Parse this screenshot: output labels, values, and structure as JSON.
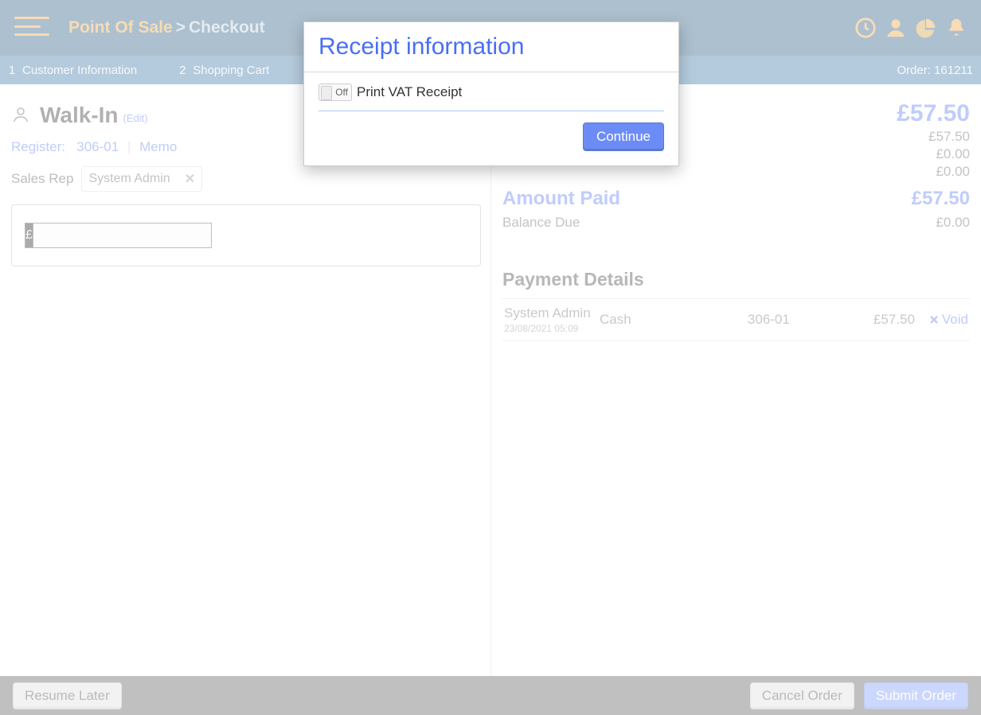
{
  "header": {
    "app_name": "Point Of Sale",
    "separator": ">",
    "location": "Checkout"
  },
  "progress": {
    "steps": [
      {
        "n": "1",
        "label": "Customer Information"
      },
      {
        "n": "2",
        "label": "Shopping Cart"
      },
      {
        "n": "3",
        "label": ""
      }
    ],
    "order_prefix": "Order:",
    "order_number": "161211"
  },
  "customer": {
    "name": "Walk-In",
    "edit_label": "(Edit)",
    "register_label": "Register:",
    "register_value": "306-01",
    "memo_label": "Memo"
  },
  "salesrep": {
    "label": "Sales Rep",
    "value": "System Admin"
  },
  "price_input": {
    "currency": "£",
    "value": ""
  },
  "summary": {
    "total_amount": "£57.50",
    "line1_amount": "£57.50",
    "line2_amount": "£0.00",
    "line3_amount": "£0.00",
    "paid_label": "Amount Paid",
    "paid_amount": "£57.50",
    "balance_label": "Balance Due",
    "balance_amount": "£0.00"
  },
  "payments": {
    "title": "Payment Details",
    "rows": [
      {
        "who": "System Admin",
        "timestamp": "23/08/2021 05:09",
        "method": "Cash",
        "register": "306-01",
        "amount": "£57.50",
        "void_label": "Void"
      }
    ]
  },
  "footer": {
    "resume_label": "Resume Later",
    "cancel_label": "Cancel Order",
    "submit_label": "Submit Order"
  },
  "modal": {
    "title": "Receipt information",
    "toggle_state": "Off",
    "toggle_label": "Print VAT Receipt",
    "continue_label": "Continue"
  }
}
